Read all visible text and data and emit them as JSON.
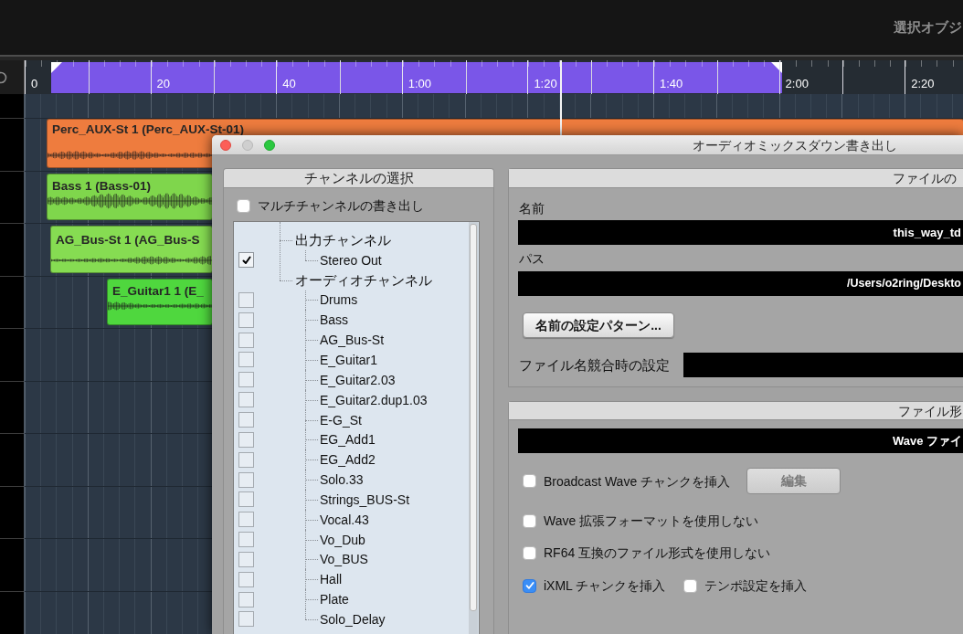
{
  "top_bar": {
    "title": "選択オブジ"
  },
  "ruler": {
    "labels": [
      "0",
      "20",
      "40",
      "1:00",
      "1:20",
      "1:40",
      "2:00",
      "2:20"
    ]
  },
  "clips": [
    {
      "name": "Perc_AUX-St 1 (Perc_AUX-St-01)",
      "color": "#ee7c3e"
    },
    {
      "name": "Bass 1 (Bass-01)",
      "color": "#7fd64c"
    },
    {
      "name": "AG_Bus-St 1 (AG_Bus-S",
      "color": "#86dc52"
    },
    {
      "name": "E_Guitar1 1 (E_",
      "color": "#4fd73e"
    }
  ],
  "dialog": {
    "title": "オーディオミックスダウン書き出し",
    "channels": {
      "title": "チャンネルの選択",
      "multichannel": {
        "label": "マルチチャンネルの書き出し",
        "checked": false
      },
      "tree": [
        {
          "label": "出力チャンネル",
          "children": [
            {
              "label": "Stereo Out",
              "checked": true
            }
          ]
        },
        {
          "label": "オーディオチャンネル",
          "children": [
            {
              "label": "Drums",
              "checked": false
            },
            {
              "label": "Bass",
              "checked": false
            },
            {
              "label": "AG_Bus-St",
              "checked": false
            },
            {
              "label": "E_Guitar1",
              "checked": false
            },
            {
              "label": "E_Guitar2.03",
              "checked": false
            },
            {
              "label": "E_Guitar2.dup1.03",
              "checked": false
            },
            {
              "label": "E-G_St",
              "checked": false
            },
            {
              "label": "EG_Add1",
              "checked": false
            },
            {
              "label": "EG_Add2",
              "checked": false
            },
            {
              "label": "Solo.33",
              "checked": false
            },
            {
              "label": "Strings_BUS-St",
              "checked": false
            },
            {
              "label": "Vocal.43",
              "checked": false
            },
            {
              "label": "Vo_Dub",
              "checked": false
            },
            {
              "label": "Vo_BUS",
              "checked": false
            },
            {
              "label": "Hall",
              "checked": false
            },
            {
              "label": "Plate",
              "checked": false
            },
            {
              "label": "Solo_Delay",
              "checked": false
            }
          ]
        }
      ]
    },
    "file_location": {
      "title": "ファイルの",
      "name": {
        "label": "名前",
        "value": "this_way_td"
      },
      "path": {
        "label": "パス",
        "value": "/Users/o2ring/Deskto"
      },
      "pattern_button": "名前の設定パターン...",
      "conflict": {
        "label": "ファイル名競合時の設定"
      }
    },
    "file_format": {
      "title": "ファイル形",
      "format": {
        "value": "Wave ファイ"
      },
      "option_rows": [
        {
          "options": [
            {
              "label": "Broadcast Wave チャンクを挿入",
              "checked": false
            }
          ],
          "button": {
            "label": "編集",
            "disabled": true
          }
        },
        {
          "options": [
            {
              "label": "Wave 拡張フォーマットを使用しない",
              "checked": false
            }
          ]
        },
        {
          "options": [
            {
              "label": "RF64 互換のファイル形式を使用しない",
              "checked": false
            }
          ]
        },
        {
          "options": [
            {
              "label": "iXML チャンクを挿入",
              "checked": true
            },
            {
              "label": "テンポ設定を挿入",
              "checked": false
            }
          ]
        }
      ]
    }
  }
}
